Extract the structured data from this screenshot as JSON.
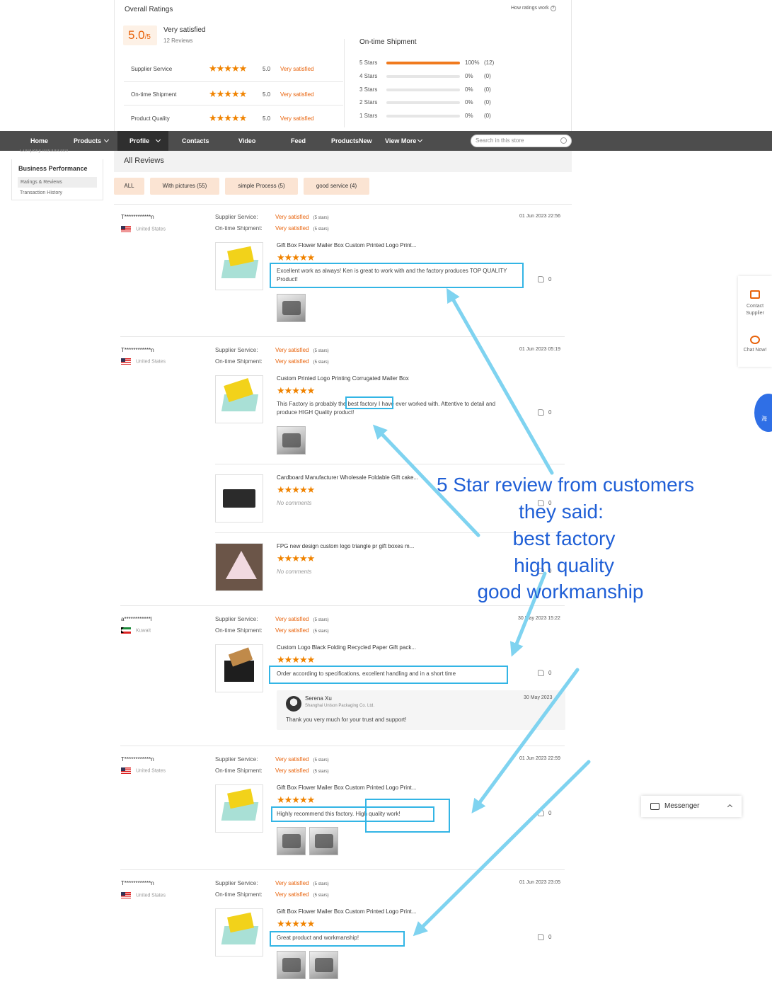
{
  "ratings": {
    "overall_title": "Overall Ratings",
    "how_link": "How ratings work",
    "score": "5.0",
    "score_den": "/5",
    "score_text": "Very satisfied",
    "review_count": "12 Reviews",
    "rows": [
      {
        "label": "Supplier Service",
        "stars": "★★★★★",
        "value": "5.0",
        "text": "Very satisfied"
      },
      {
        "label": "On-time Shipment",
        "stars": "★★★★★",
        "value": "5.0",
        "text": "Very satisfied"
      },
      {
        "label": "Product Quality",
        "stars": "★★★★★",
        "value": "5.0",
        "text": "Very satisfied"
      }
    ],
    "ots_title": "On-time Shipment",
    "distribution": [
      {
        "label": "5 Stars",
        "fraction": 1.0,
        "pct": "100%",
        "count": "(12)"
      },
      {
        "label": "4 Stars",
        "fraction": 0,
        "pct": "0%",
        "count": "(0)"
      },
      {
        "label": "3 Stars",
        "fraction": 0,
        "pct": "0%",
        "count": "(0)"
      },
      {
        "label": "2 Stars",
        "fraction": 0,
        "pct": "0%",
        "count": "(0)"
      },
      {
        "label": "1 Stars",
        "fraction": 0,
        "pct": "0%",
        "count": "(0)"
      }
    ]
  },
  "nav": {
    "items": [
      "Home",
      "Products",
      "Profile",
      "Contacts",
      "Video",
      "Feed",
      "ProductsNew",
      "View More"
    ],
    "search_placeholder": "Search in this store"
  },
  "sidebar": {
    "cut_item": "Company Introduction",
    "heading": "Business Performance",
    "active_item": "Ratings & Reviews",
    "item": "Transaction History"
  },
  "reviews_header": "All Reviews",
  "filters": [
    "ALL",
    "With pictures (55)",
    "simple Process (5)",
    "good service (4)"
  ],
  "labels": {
    "supplier_service": "Supplier Service:",
    "ontime_shipment": "On-time Shipment:",
    "very_satisfied": "Very satisfied",
    "five_stars": "(5 stars)",
    "no_comments": "No comments",
    "stars": "★★★★★"
  },
  "reviews": [
    {
      "user": "T************n",
      "country": "United States",
      "date": "01 Jun 2023 22:56",
      "title": "Gift Box Flower Mailer Box Custom Printed Logo Print...",
      "text": "Excellent work as always! Ken is great to work with and the factory produces TOP QUALITY Product!",
      "likes": "0"
    },
    {
      "user": "T************n",
      "country": "United States",
      "date": "01 Jun 2023 05:19",
      "title": "Custom Printed Logo Printing Corrugated Mailer Box",
      "text": "This Factory is probably the best factory I have ever worked with. Attentive to detail and produce HIGH Quality product!",
      "likes": "0",
      "sub": [
        {
          "title": "Cardboard Manufacturer Wholesale Foldable Gift cake...",
          "likes": "0"
        },
        {
          "title": "FPG new design custom logo triangle pr gift boxes m...",
          "likes": "0"
        }
      ]
    },
    {
      "user": "a************l",
      "country": "Kuwait",
      "date": "30 May 2023 15:22",
      "title": "Custom Logo Black Folding Recycled Paper Gift pack...",
      "text": "Order according to specifications, excellent handling and in a short time",
      "likes": "0",
      "reply": {
        "name": "Serena Xu",
        "company": "Shanghai Unison Packaging Co. Ltd.",
        "date": "30 May 2023",
        "text": "Thank you very much for your trust and support!"
      }
    },
    {
      "user": "T************n",
      "country": "United States",
      "date": "01 Jun 2023 22:59",
      "title": "Gift Box Flower Mailer Box Custom Printed Logo Print...",
      "text": "Highly recommend this factory. High quality work!",
      "likes": "0"
    },
    {
      "user": "T************n",
      "country": "United States",
      "date": "01 Jun 2023 23:05",
      "title": "Gift Box Flower Mailer Box Custom Printed Logo Print...",
      "text": "Great product and workmanship!",
      "likes": "0"
    }
  ],
  "widgets": {
    "contact": "Contact Supplier",
    "chat": "Chat Now!",
    "bot": "海",
    "messenger": "Messenger"
  },
  "annotation": {
    "lines": [
      "5 Star review from customers",
      "they said:",
      "best factory",
      "high quality",
      "good workmanship"
    ],
    "color": "#1f5fd6",
    "arrow_color": "#7fd3f0"
  }
}
